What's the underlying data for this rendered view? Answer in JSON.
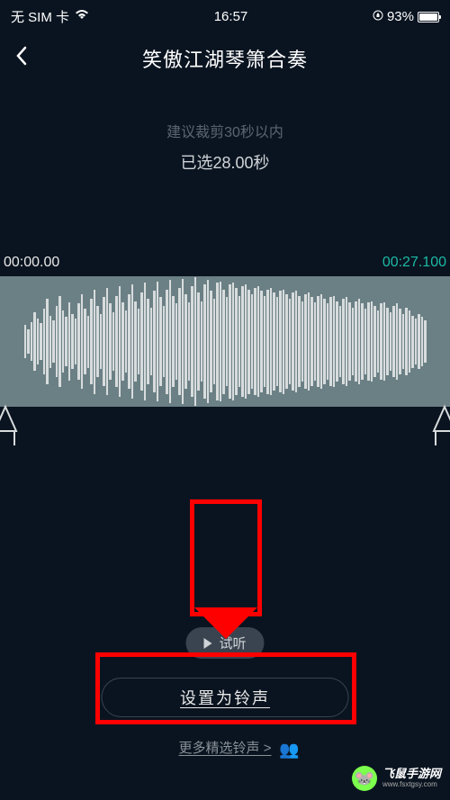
{
  "statusBar": {
    "carrier": "无 SIM 卡",
    "time": "16:57",
    "battery": "93%"
  },
  "nav": {
    "title": "笑傲江湖琴箫合奏"
  },
  "editor": {
    "hint": "建议裁剪30秒以内",
    "selected": "已选28.00秒",
    "startTime": "00:00.00",
    "endTime": "00:27.100"
  },
  "actions": {
    "preview": "试听",
    "setRingtone": "设置为铃声",
    "more": "更多精选铃声 >"
  },
  "watermark": {
    "main": "飞鼠手游网",
    "sub": "www.fsxtgsy.com"
  }
}
